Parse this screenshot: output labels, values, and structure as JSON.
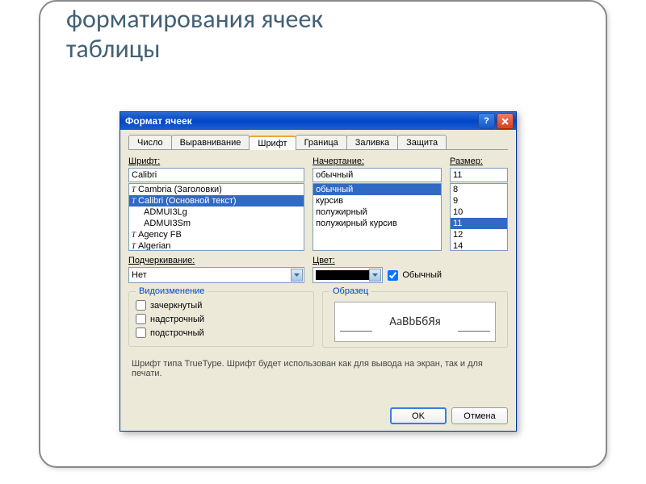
{
  "slide": {
    "title_line1": "форматирования ячеек",
    "title_line2": "таблицы"
  },
  "dialog": {
    "title": "Формат ячеек",
    "tabs": [
      "Число",
      "Выравнивание",
      "Шрифт",
      "Граница",
      "Заливка",
      "Защита"
    ],
    "active_tab": 2,
    "font": {
      "label": "Шрифт:",
      "value": "Calibri",
      "list": [
        "Cambria (Заголовки)",
        "Calibri (Основной текст)",
        "ADMUI3Lg",
        "ADMUI3Sm",
        "Agency FB",
        "Algerian"
      ],
      "selected": 1
    },
    "style": {
      "label": "Начертание:",
      "value": "обычный",
      "list": [
        "обычный",
        "курсив",
        "полужирный",
        "полужирный курсив"
      ],
      "selected": 0
    },
    "size": {
      "label": "Размер:",
      "value": "11",
      "list": [
        "8",
        "9",
        "10",
        "11",
        "12",
        "14"
      ],
      "selected": 3
    },
    "underline": {
      "label": "Подчеркивание:",
      "value": "Нет"
    },
    "color": {
      "label": "Цвет:",
      "swatch": "#000000",
      "normal_checked": true,
      "normal_label": "Обычный"
    },
    "effects": {
      "title": "Видоизменение",
      "items": [
        "зачеркнутый",
        "надстрочный",
        "подстрочный"
      ]
    },
    "sample": {
      "title": "Образец",
      "text": "AaBbБбЯя"
    },
    "info": "Шрифт типа TrueType. Шрифт будет использован как для вывода на экран, так и для печати.",
    "ok": "OK",
    "cancel": "Отмена"
  }
}
